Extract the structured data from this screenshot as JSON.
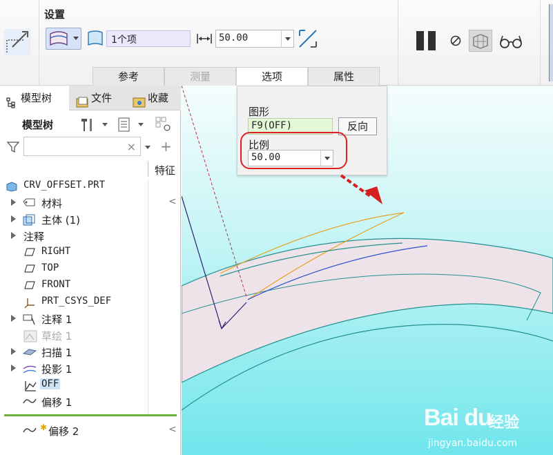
{
  "ribbon": {
    "section_title": "设置",
    "items_field": "1个项",
    "value_field": "50.00",
    "tabs": [
      {
        "label": "参考",
        "state": "normal"
      },
      {
        "label": "测量",
        "state": "disabled"
      },
      {
        "label": "选项",
        "state": "active"
      },
      {
        "label": "属性",
        "state": "normal"
      }
    ],
    "icons": [
      "offset-curve-icon",
      "surface-icon",
      "dimension-icon",
      "flip-direction-icon",
      "pause-icon",
      "stop-icon",
      "preview-icon",
      "glasses-icon"
    ]
  },
  "options_panel": {
    "graphic_label": "图形",
    "graphic_value": "F9(OFF)",
    "reverse_button": "反向",
    "scale_label": "比例",
    "scale_value": "50.00"
  },
  "left_panel": {
    "tabs": [
      "模型树",
      "文件",
      "收藏"
    ],
    "tree_label": "模型树",
    "column_header": "特征",
    "rows": [
      {
        "label": "CRV_OFFSET.PRT",
        "icon": "part-icon"
      },
      {
        "label": "材料",
        "icon": "material-icon"
      },
      {
        "label": "主体 (1)",
        "icon": "body-icon"
      },
      {
        "label": "注释",
        "icon": ""
      },
      {
        "label": "RIGHT",
        "icon": "datum-plane-icon"
      },
      {
        "label": "TOP",
        "icon": "datum-plane-icon"
      },
      {
        "label": "FRONT",
        "icon": "datum-plane-icon"
      },
      {
        "label": "PRT_CSYS_DEF",
        "icon": "csys-icon"
      },
      {
        "label": "注释 1",
        "icon": "annotation-icon"
      },
      {
        "label": "草绘 1",
        "icon": "sketch-icon"
      },
      {
        "label": "扫描 1",
        "icon": "sweep-icon"
      },
      {
        "label": "投影 1",
        "icon": "projection-icon"
      },
      {
        "label": "OFF",
        "icon": "graph-icon"
      },
      {
        "label": "偏移 1",
        "icon": "offset-icon"
      }
    ],
    "insert_row": "偏移 2"
  },
  "colors": {
    "highlight": "#e02020",
    "graphics_bg": "#6fe6ec",
    "selection": "#cfe3f7",
    "insert_bar": "#6db33f"
  },
  "watermark": {
    "brand": "Bai du",
    "brand_cn": "经验",
    "url": "jingyan.baidu.com"
  }
}
